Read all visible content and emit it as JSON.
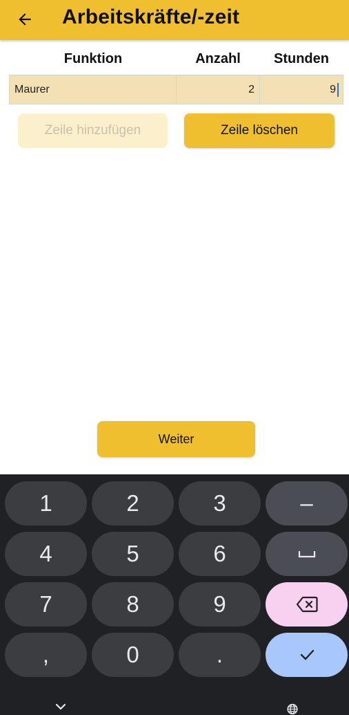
{
  "appbar": {
    "title": "Arbeitskräfte/-zeit"
  },
  "table": {
    "headers": [
      "Funktion",
      "Anzahl",
      "Stunden"
    ],
    "row": {
      "funktion": "Maurer",
      "anzahl": "2",
      "stunden": "9"
    }
  },
  "actions": {
    "add_row": "Zeile hinzufügen",
    "delete_row": "Zeile löschen",
    "next": "Weiter"
  },
  "keyboard": {
    "digits": [
      "1",
      "2",
      "3",
      "4",
      "5",
      "6",
      "7",
      "8",
      "9",
      "0"
    ],
    "minus": "–",
    "comma": ",",
    "period": "."
  },
  "colors": {
    "accent": "#f0bf30",
    "cell_bg": "#f3e1b5",
    "disabled_bg": "#fcefcc",
    "keyboard_bg": "#202124"
  }
}
